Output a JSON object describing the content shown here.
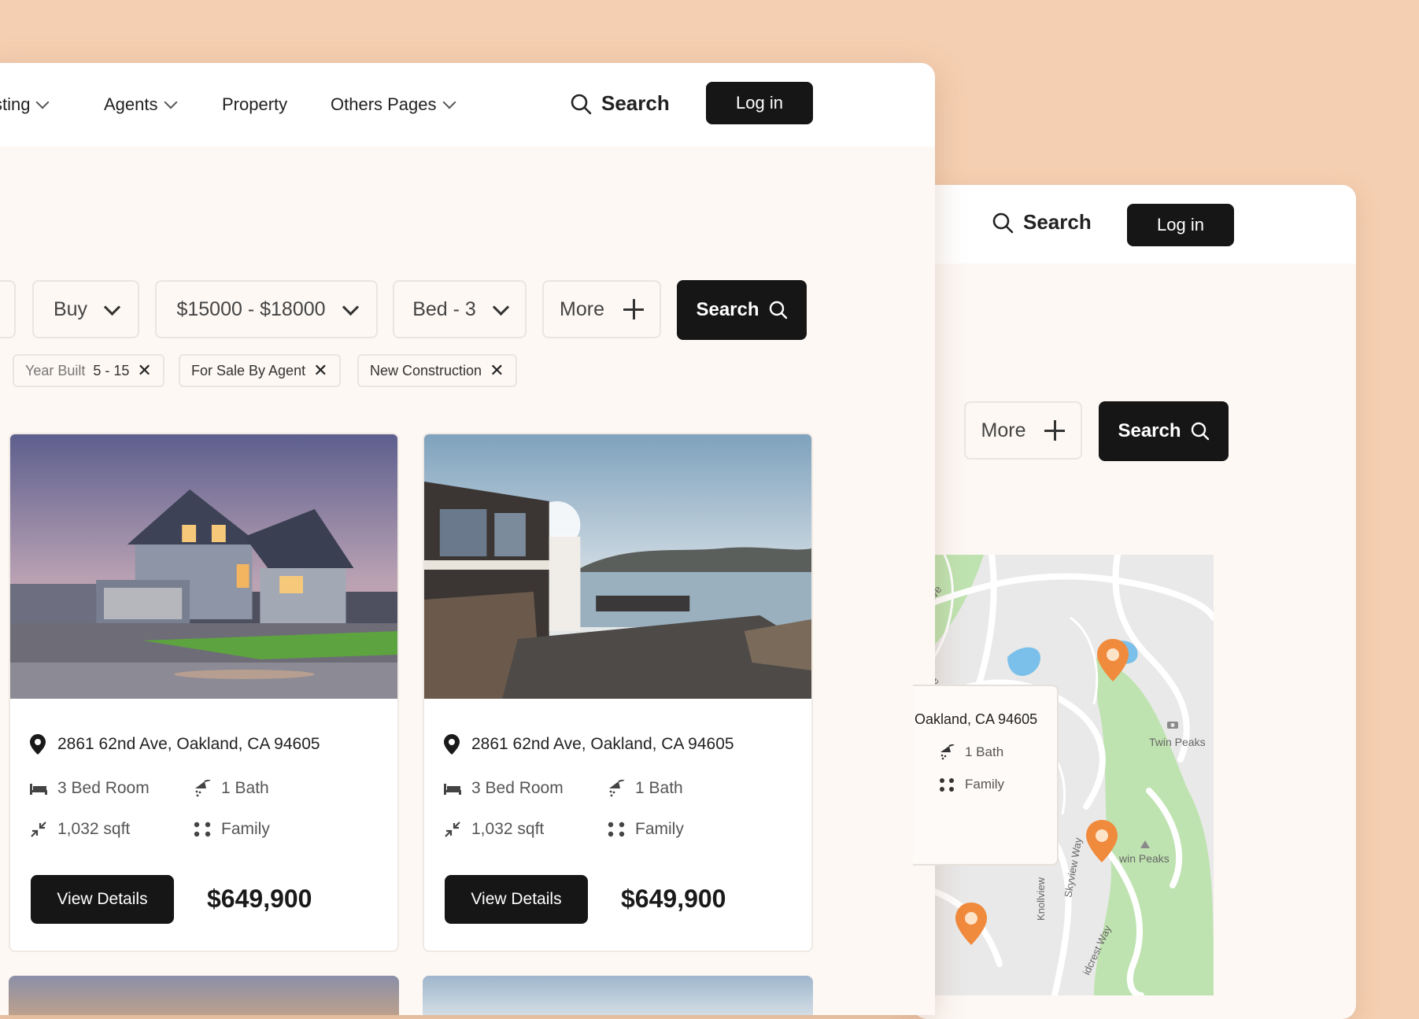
{
  "colors": {
    "background": "#f5cfb1",
    "panel": "#fdf8f4",
    "dark_button": "#161616",
    "map_pin": "#f08a3c",
    "map_park": "#bfe3b0"
  },
  "front": {
    "nav": {
      "items": [
        {
          "label": "sting",
          "has_dropdown": true
        },
        {
          "label": "Agents",
          "has_dropdown": true
        },
        {
          "label": "Property",
          "has_dropdown": false
        },
        {
          "label": "Others Pages",
          "has_dropdown": true
        }
      ],
      "search_label": "Search",
      "login_label": "Log in"
    },
    "filters": {
      "type_value": "Buy",
      "price_value": "$15000 - $18000",
      "bed_value": "Bed - 3",
      "more_label": "More",
      "search_label": "Search"
    },
    "chips": [
      {
        "label": "Year Built",
        "value": "5 - 15"
      },
      {
        "label": "For Sale By Agent",
        "value": ""
      },
      {
        "label": "New Construction",
        "value": ""
      }
    ],
    "listings": [
      {
        "address": "2861 62nd Ave, Oakland, CA 94605",
        "bedrooms": "3 Bed Room",
        "baths": "1 Bath",
        "area": "1,032 sqft",
        "type": "Family",
        "button_label": "View Details",
        "price": "$649,900"
      },
      {
        "address": "2861 62nd Ave, Oakland, CA 94605",
        "bedrooms": "3 Bed Room",
        "baths": "1 Bath",
        "area": "1,032 sqft",
        "type": "Family",
        "button_label": "View Details",
        "price": "$649,900"
      }
    ]
  },
  "back": {
    "nav": {
      "search_label": "Search",
      "login_label": "Log in"
    },
    "filters": {
      "more_label": "More",
      "search_label": "Search"
    },
    "map": {
      "popup": {
        "address": "Oakland, CA 94605",
        "baths": "1 Bath",
        "type": "Family"
      },
      "labels": {
        "twin_peaks_1": "Twin Peaks",
        "twin_peaks_2": "win Peaks",
        "street_1": "ehr Ave",
        "street_2": "ve",
        "skyview": "Skyview Way",
        "knollview": "Knollview",
        "midcrest": "idcrest Way"
      }
    }
  }
}
